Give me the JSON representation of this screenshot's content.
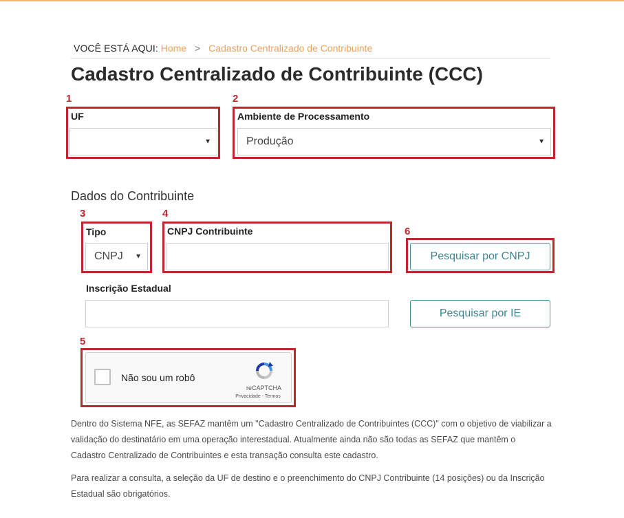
{
  "breadcrumb": {
    "prefix": "VOCÊ ESTÁ AQUI:",
    "home": "Home",
    "separator": ">",
    "current": "Cadastro Centralizado de Contribuinte"
  },
  "page_title": "Cadastro Centralizado de Contribuinte (CCC)",
  "markers": [
    "1",
    "2",
    "3",
    "4",
    "5",
    "6"
  ],
  "form": {
    "uf": {
      "label": "UF",
      "value": ""
    },
    "ambiente": {
      "label": "Ambiente de Processamento",
      "value": "Produção"
    },
    "section_title": "Dados do Contribuinte",
    "tipo": {
      "label": "Tipo",
      "value": "CNPJ"
    },
    "cnpj": {
      "label": "CNPJ Contribuinte",
      "value": ""
    },
    "ie": {
      "label": "Inscrição Estadual",
      "value": ""
    },
    "buttons": {
      "search_cnpj": "Pesquisar por CNPJ",
      "search_ie": "Pesquisar por IE"
    }
  },
  "captcha": {
    "label": "Não sou um robô",
    "brand": "reCAPTCHA",
    "links": "Privacidade - Termos"
  },
  "info": {
    "paragraph1": "Dentro do Sistema NFE, as SEFAZ mantêm um \"Cadastro Centralizado de Contribuintes (CCC)\" com o objetivo de viabilizar a validação do destinatário em uma operação interestadual. Atualmente ainda não são todas as SEFAZ que mantêm o Cadastro Centralizado de Contribuintes e esta transação consulta este cadastro.",
    "paragraph2": "Para realizar a consulta, a seleção da UF de destino e o preenchimento do CNPJ Contribuinte (14 posições) ou da Inscrição Estadual são obrigatórios."
  },
  "colors": {
    "accent_orange": "#e8a25a",
    "annotation_red": "#c0272d",
    "button_teal": "#3f8693"
  }
}
